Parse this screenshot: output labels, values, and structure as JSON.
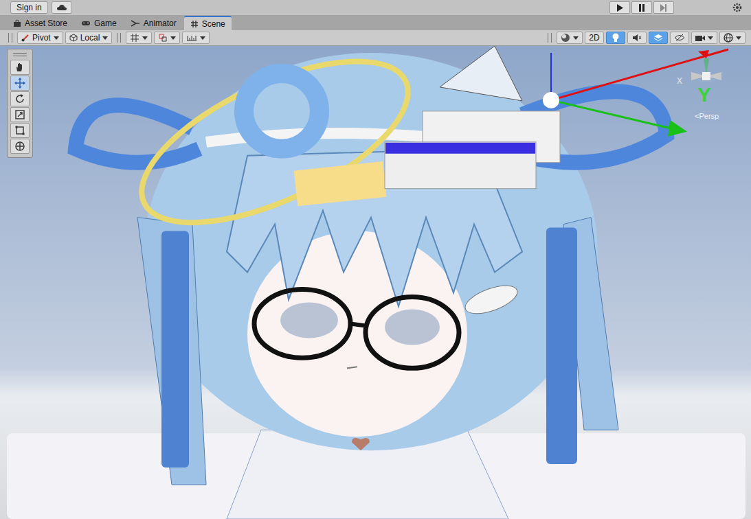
{
  "account": {
    "sign_in": "Sign in"
  },
  "tabs": [
    {
      "label": "Asset Store",
      "kind": "store",
      "selected": false
    },
    {
      "label": "Game",
      "kind": "game",
      "selected": false
    },
    {
      "label": "Animator",
      "kind": "animator",
      "selected": false
    },
    {
      "label": "Scene",
      "kind": "scene",
      "selected": true
    }
  ],
  "scene_toolbar": {
    "pivot": "Pivot",
    "space": "Local",
    "view_2d": {
      "label": "2D",
      "on": false
    },
    "toggles": [
      {
        "kind": "lighting",
        "on": true
      },
      {
        "kind": "audio",
        "on": false
      },
      {
        "kind": "effects",
        "on": true
      },
      {
        "kind": "visibility",
        "on": false
      }
    ]
  },
  "tools": [
    {
      "kind": "hand",
      "selected": false
    },
    {
      "kind": "move",
      "selected": true
    },
    {
      "kind": "rotate",
      "selected": false
    },
    {
      "kind": "scale",
      "selected": false
    },
    {
      "kind": "rect",
      "selected": false
    },
    {
      "kind": "transform",
      "selected": false
    }
  ],
  "gizmo": {
    "y_label": "Y",
    "x_label": "X",
    "projection": "Persp"
  }
}
